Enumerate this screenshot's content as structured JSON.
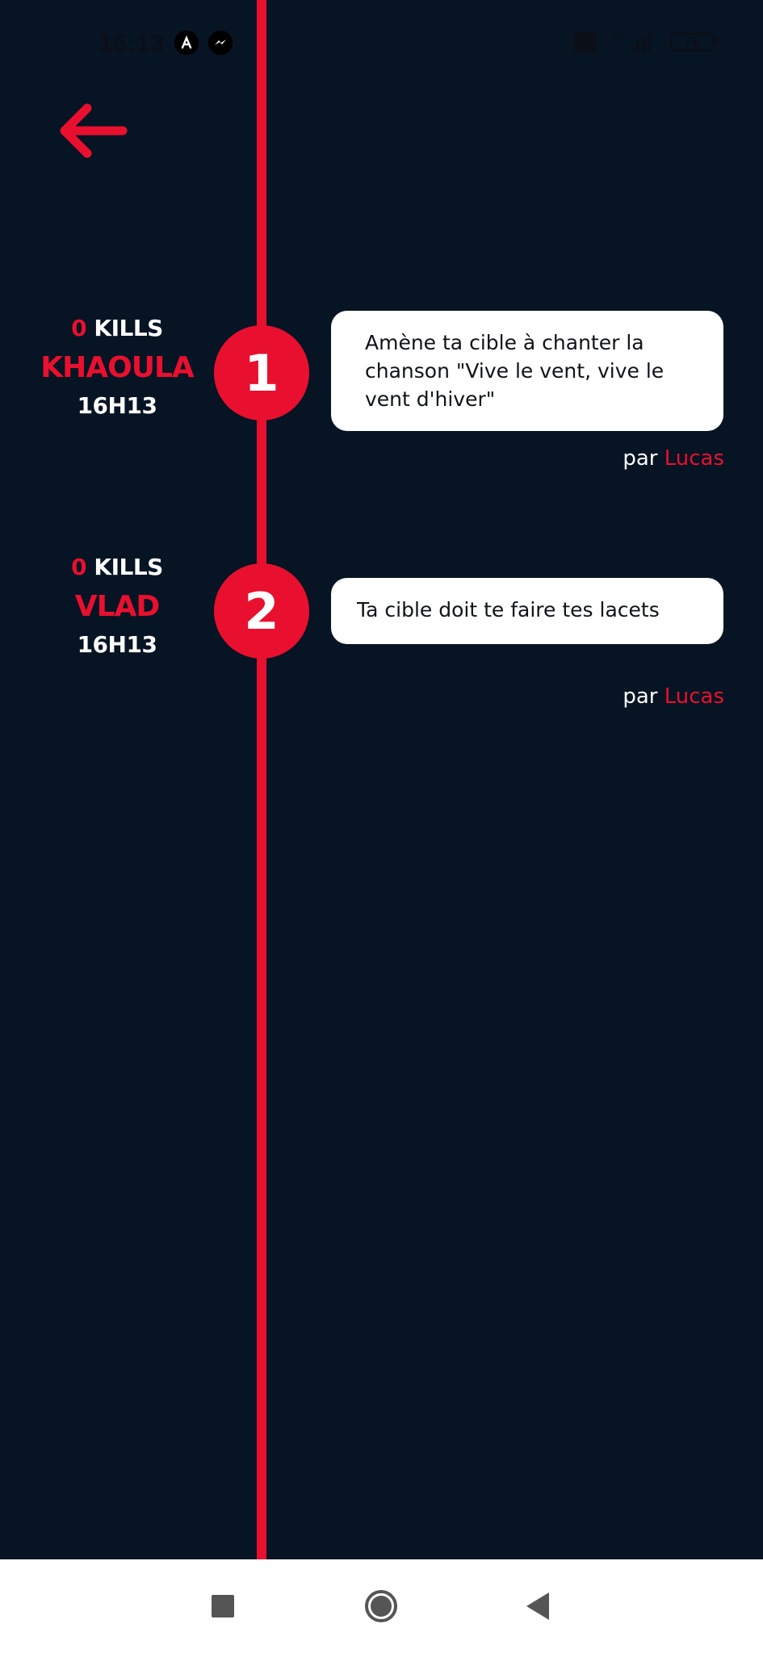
{
  "status_bar": {
    "time": "16:13",
    "network": "4G",
    "battery": "76",
    "icons": [
      "app-icon",
      "messenger-icon",
      "notification-icon",
      "signal-icon",
      "battery-icon"
    ]
  },
  "header": {
    "back_icon": "arrow-left-icon"
  },
  "colors": {
    "background": "#071424",
    "accent": "#e8102e",
    "card": "#ffffff"
  },
  "entries": [
    {
      "rank": "1",
      "kills_count": "0",
      "kills_label": "KILLS",
      "player": "KHAOULA",
      "time": "16H13",
      "mission": "Amène ta cible à chanter la chanson \"Vive le vent, vive le vent d'hiver\"",
      "author_prefix": "par",
      "author": "Lucas"
    },
    {
      "rank": "2",
      "kills_count": "0",
      "kills_label": "KILLS",
      "player": "VLAD",
      "time": "16H13",
      "mission": "Ta cible doit te faire tes lacets",
      "author_prefix": "par",
      "author": "Lucas"
    }
  ],
  "nav_bar": {
    "buttons": [
      "recent-apps",
      "home",
      "back"
    ]
  }
}
